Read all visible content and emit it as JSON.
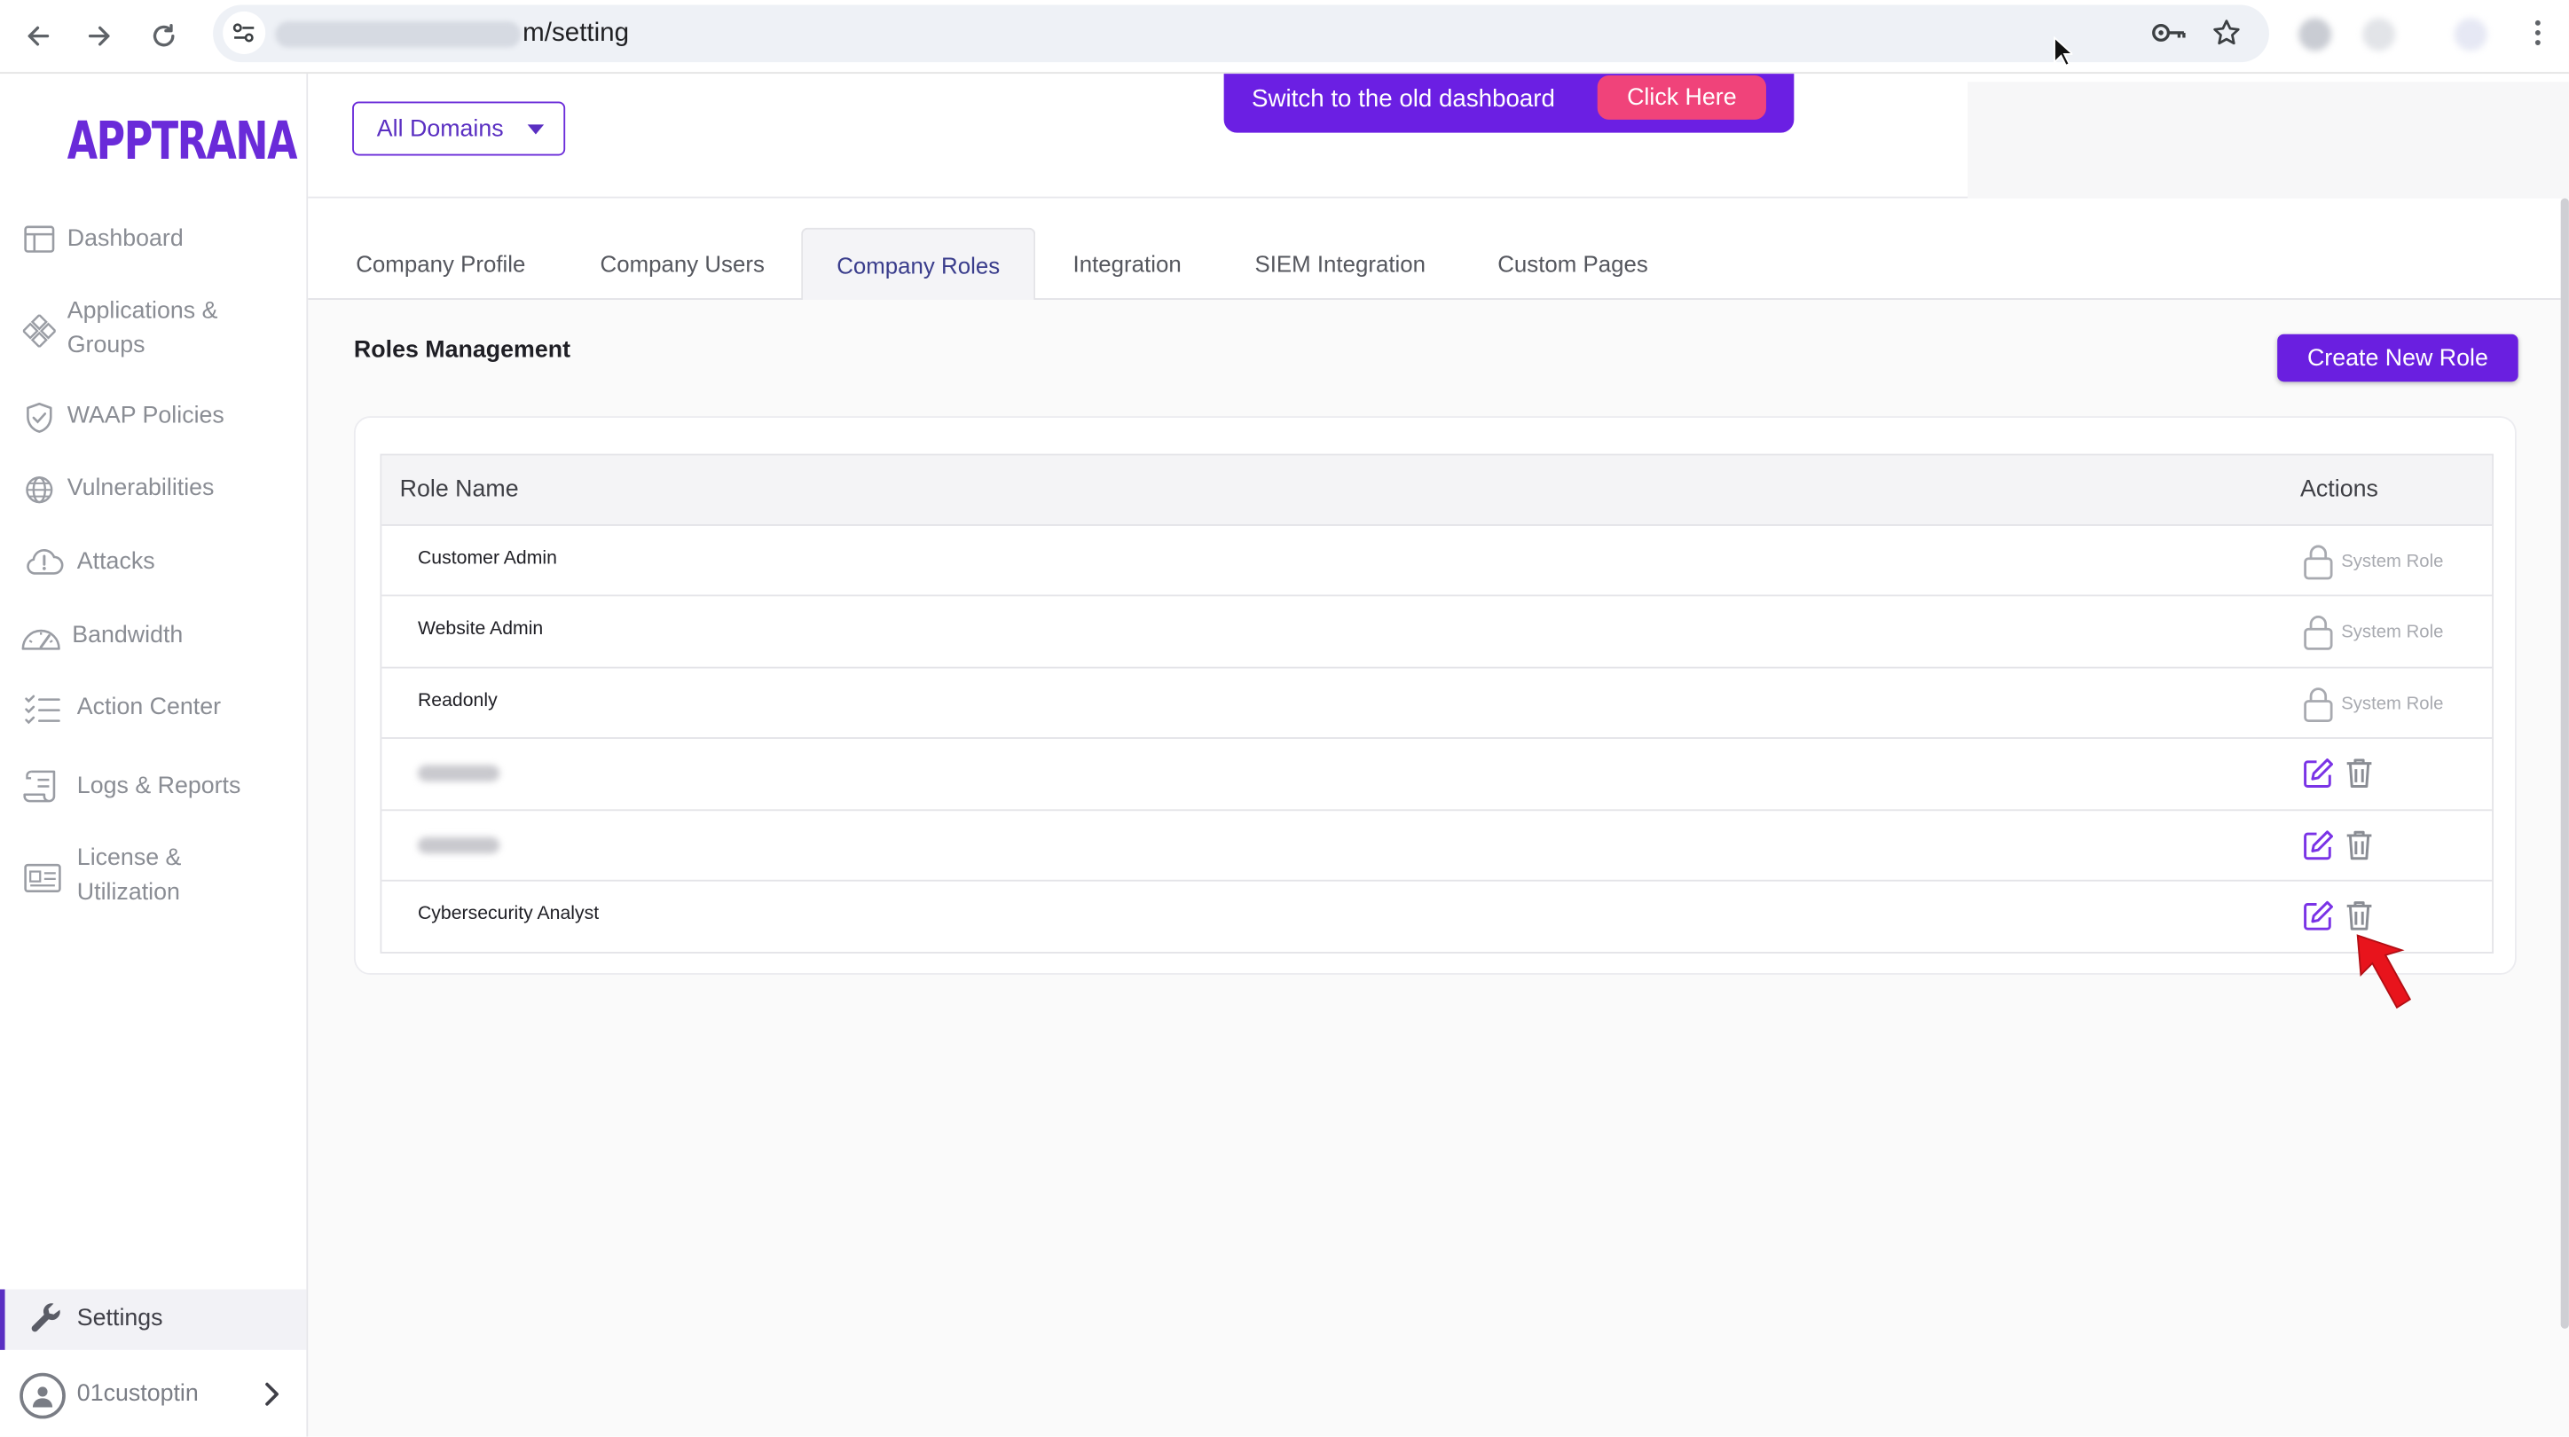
{
  "browser": {
    "url_visible": "m/setting"
  },
  "brand": {
    "logo_text": "APPTRANA",
    "accent": "#6a2bd9"
  },
  "sidebar": {
    "items": [
      {
        "label": "Dashboard",
        "icon": "layout-icon"
      },
      {
        "label_line1": "Applications &",
        "label_line2": "Groups",
        "icon": "diamond-nodes-icon"
      },
      {
        "label": "WAAP Policies",
        "icon": "shield-check-icon"
      },
      {
        "label": "Vulnerabilities",
        "icon": "bug-globe-icon"
      },
      {
        "label": "Attacks",
        "icon": "cloud-alert-icon"
      },
      {
        "label": "Bandwidth",
        "icon": "gauge-icon"
      },
      {
        "label": "Action Center",
        "icon": "checklist-icon"
      },
      {
        "label": "Logs & Reports",
        "icon": "scroll-icon"
      },
      {
        "label_line1": "License &",
        "label_line2": "Utilization",
        "icon": "id-card-icon"
      }
    ],
    "settings_label": "Settings",
    "user_name": "01custoptin"
  },
  "topbar": {
    "domain_select": "All Domains",
    "banner_text": "Switch to the old dashboard",
    "banner_button": "Click Here",
    "banner_color": "#6b1fe3",
    "banner_button_color": "#f0437a"
  },
  "tabs": [
    {
      "label": "Company Profile",
      "active": false
    },
    {
      "label": "Company Users",
      "active": false
    },
    {
      "label": "Company Roles",
      "active": true
    },
    {
      "label": "Integration",
      "active": false
    },
    {
      "label": "SIEM Integration",
      "active": false
    },
    {
      "label": "Custom Pages",
      "active": false
    }
  ],
  "roles": {
    "title": "Roles Management",
    "create_button": "Create New Role",
    "columns": {
      "name": "Role Name",
      "actions": "Actions"
    },
    "system_role_label": "System Role",
    "rows": [
      {
        "name": "Customer Admin",
        "type": "system"
      },
      {
        "name": "Website Admin",
        "type": "system"
      },
      {
        "name": "Readonly",
        "type": "system"
      },
      {
        "name": "",
        "type": "custom",
        "redacted": true
      },
      {
        "name": "",
        "type": "custom",
        "redacted": true
      },
      {
        "name": "Cybersecurity Analyst",
        "type": "custom"
      }
    ]
  }
}
